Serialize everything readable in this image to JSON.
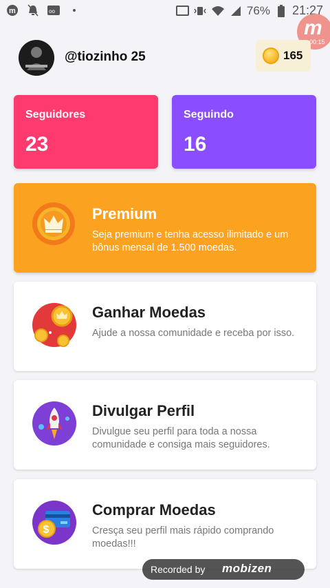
{
  "status_bar": {
    "battery_percent": "76%",
    "time": "21:27",
    "left_icons": [
      "mobizen-icon",
      "bell-off-icon",
      "voicemail-icon",
      "dot-icon"
    ],
    "right_icons": [
      "cast-icon",
      "vibrate-icon",
      "wifi-icon",
      "signal-icon",
      "battery-icon"
    ],
    "recording_bubble": {
      "letter": "m",
      "timer": "00:15"
    }
  },
  "profile": {
    "username": "@tiozinho 25",
    "coins": "165"
  },
  "stats": {
    "followers_label": "Seguidores",
    "followers_value": "23",
    "following_label": "Seguindo",
    "following_value": "16"
  },
  "menu": [
    {
      "title": "Premium",
      "desc": "Seja premium e tenha acesso ilimitado e um bônus mensal de 1.500 moedas."
    },
    {
      "title": "Ganhar Moedas",
      "desc": "Ajude a nossa comunidade e receba por isso."
    },
    {
      "title": "Divulgar Perfil",
      "desc": "Divulgue seu perfil para toda a nossa comunidade e consiga mais seguidores."
    },
    {
      "title": "Comprar Moedas",
      "desc": "Cresça seu perfil mais rápido comprando moedas!!!"
    }
  ],
  "recording": {
    "label": "Recorded by",
    "brand": "mobizen"
  },
  "colors": {
    "followers": "#ff3a6e",
    "following": "#8a4dff",
    "premium": "#fba221",
    "coin": "#f2b01e"
  }
}
